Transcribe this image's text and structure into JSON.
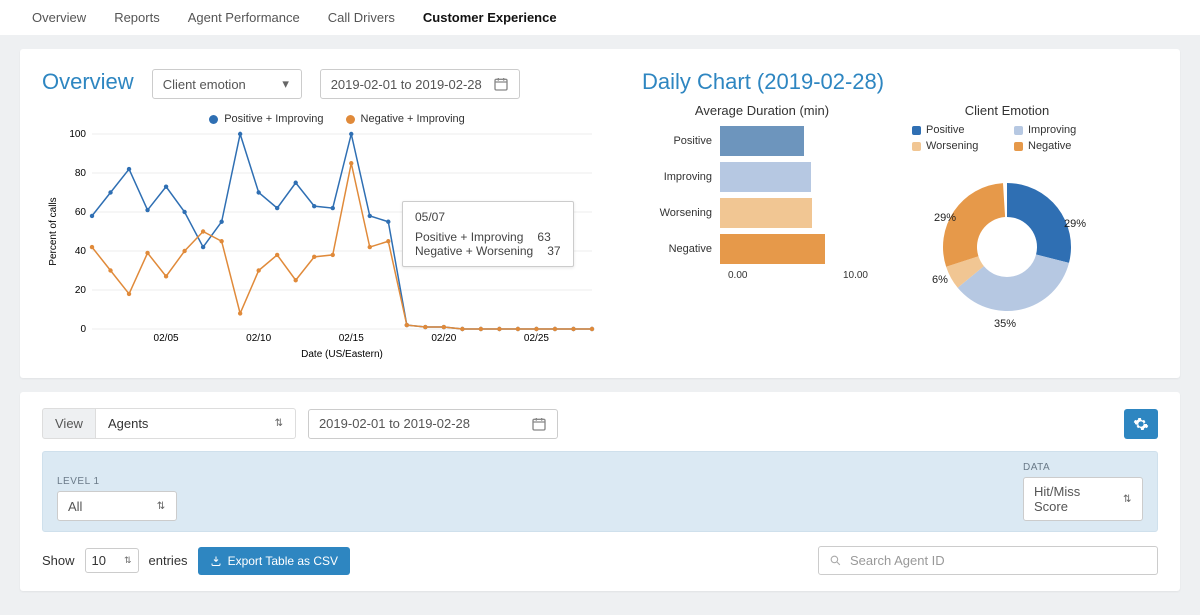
{
  "tabs": [
    "Overview",
    "Reports",
    "Agent Performance",
    "Call Drivers",
    "Customer Experience"
  ],
  "active_tab": "Customer Experience",
  "overview": {
    "title": "Overview",
    "emotion_select": "Client emotion",
    "date_range": "2019-02-01 to 2019-02-28"
  },
  "legend": {
    "pos": "Positive + Improving",
    "neg": "Negative + Improving"
  },
  "ylab": "Percent of calls",
  "xlab": "Date (US/Eastern)",
  "tooltip": {
    "date": "05/07",
    "pos_label": "Positive + Improving",
    "pos_val": "63",
    "neg_label": "Negative + Worsening",
    "neg_val": "37"
  },
  "daily_title": "Daily Chart (2019-02-28)",
  "bar_title": "Average Duration (min)",
  "bar_cats": {
    "pos": "Positive",
    "imp": "Improving",
    "wor": "Worsening",
    "neg": "Negative"
  },
  "bar_axis": {
    "min": "0.00",
    "max": "10.00"
  },
  "donut_title": "Client Emotion",
  "donut_legend": {
    "pos": "Positive",
    "imp": "Improving",
    "wor": "Worsening",
    "neg": "Negative"
  },
  "donut_labels": {
    "pos": "29%",
    "imp": "35%",
    "wor": "6%",
    "neg": "29%"
  },
  "view": {
    "label": "View",
    "value": "Agents",
    "date_range": "2019-02-01 to 2019-02-28"
  },
  "filters": {
    "level1_label": "LEVEL 1",
    "level1_value": "All",
    "data_label": "DATA",
    "data_value": "Hit/Miss Score"
  },
  "table": {
    "show": "Show",
    "count": "10",
    "entries": "entries",
    "export": "Export Table as CSV",
    "search_placeholder": "Search Agent ID"
  },
  "chart_data": {
    "type": "line",
    "title": "Overview",
    "xlabel": "Date (US/Eastern)",
    "ylabel": "Percent of calls",
    "x": [
      "02/01",
      "02/02",
      "02/03",
      "02/04",
      "02/05",
      "02/06",
      "02/07",
      "02/08",
      "02/09",
      "02/10",
      "02/11",
      "02/12",
      "02/13",
      "02/14",
      "02/15",
      "02/16",
      "02/17",
      "02/18",
      "02/19",
      "02/20",
      "02/21",
      "02/22",
      "02/23",
      "02/24",
      "02/25",
      "02/26",
      "02/27",
      "02/28"
    ],
    "x_ticks": [
      "02/05",
      "02/10",
      "02/15",
      "02/20",
      "02/25"
    ],
    "y_ticks": [
      0,
      20,
      40,
      60,
      80,
      100
    ],
    "ylim": [
      0,
      100
    ],
    "series": [
      {
        "name": "Positive + Improving",
        "color": "#2f6fb3",
        "values": [
          58,
          70,
          82,
          61,
          73,
          60,
          42,
          55,
          100,
          70,
          62,
          75,
          63,
          62,
          100,
          58,
          55,
          2,
          1,
          1,
          0,
          0,
          0,
          0,
          0,
          0,
          0,
          0
        ]
      },
      {
        "name": "Negative + Improving",
        "color": "#e08a3a",
        "values": [
          42,
          30,
          18,
          39,
          27,
          40,
          50,
          45,
          8,
          30,
          38,
          25,
          37,
          38,
          85,
          42,
          45,
          2,
          1,
          1,
          0,
          0,
          0,
          0,
          0,
          0,
          0,
          0
        ]
      }
    ],
    "tooltip_point": {
      "x": "05/07",
      "Positive + Improving": 63,
      "Negative + Worsening": 37
    },
    "bars": {
      "type": "bar",
      "orientation": "horizontal",
      "title": "Average Duration (min)",
      "xlim": [
        0,
        10
      ],
      "categories": [
        "Positive",
        "Improving",
        "Worsening",
        "Negative"
      ],
      "values": [
        6.0,
        6.5,
        6.6,
        7.5
      ],
      "colors": [
        "#6d95bd",
        "#b6c8e2",
        "#f1c693",
        "#e6994a"
      ]
    },
    "donut": {
      "type": "pie",
      "title": "Client Emotion",
      "slices": [
        {
          "label": "Positive",
          "value": 29,
          "color": "#2f6fb3"
        },
        {
          "label": "Improving",
          "value": 35,
          "color": "#b6c8e2"
        },
        {
          "label": "Worsening",
          "value": 6,
          "color": "#f1c693"
        },
        {
          "label": "Negative",
          "value": 29,
          "color": "#e6994a"
        }
      ]
    }
  }
}
